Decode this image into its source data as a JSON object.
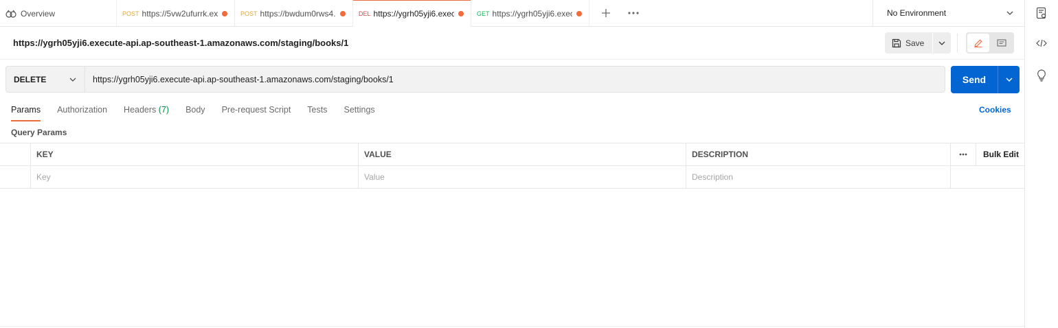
{
  "tabs": [
    {
      "method": "",
      "label": "Overview",
      "unsaved": false,
      "active": false
    },
    {
      "method": "POST",
      "label": "https://5vw2ufurrk.ex",
      "unsaved": true,
      "active": false
    },
    {
      "method": "POST",
      "label": "https://bwdum0rws4.",
      "unsaved": true,
      "active": false
    },
    {
      "method": "DEL",
      "label": "https://ygrh05yji6.exec",
      "unsaved": true,
      "active": true
    },
    {
      "method": "GET",
      "label": "https://ygrh05yji6.exec",
      "unsaved": true,
      "active": false
    }
  ],
  "environment": {
    "selected": "No Environment"
  },
  "request": {
    "name": "https://ygrh05yji6.execute-api.ap-southeast-1.amazonaws.com/staging/books/1",
    "method": "DELETE",
    "url": "https://ygrh05yji6.execute-api.ap-southeast-1.amazonaws.com/staging/books/1",
    "save_label": "Save",
    "send_label": "Send"
  },
  "subtabs": {
    "params": "Params",
    "authorization": "Authorization",
    "headers": "Headers",
    "headers_count": "(7)",
    "body": "Body",
    "prerequest": "Pre-request Script",
    "tests": "Tests",
    "settings": "Settings",
    "cookies": "Cookies"
  },
  "query_params": {
    "title": "Query Params",
    "columns": {
      "key": "KEY",
      "value": "VALUE",
      "description": "DESCRIPTION",
      "bulk_edit": "Bulk Edit"
    },
    "placeholders": {
      "key": "Key",
      "value": "Value",
      "description": "Description"
    }
  },
  "colors": {
    "accent": "#f26b3a",
    "primary": "#0265d2",
    "post": "#e6a62b",
    "delete": "#e0423b",
    "get": "#0cbb52"
  }
}
